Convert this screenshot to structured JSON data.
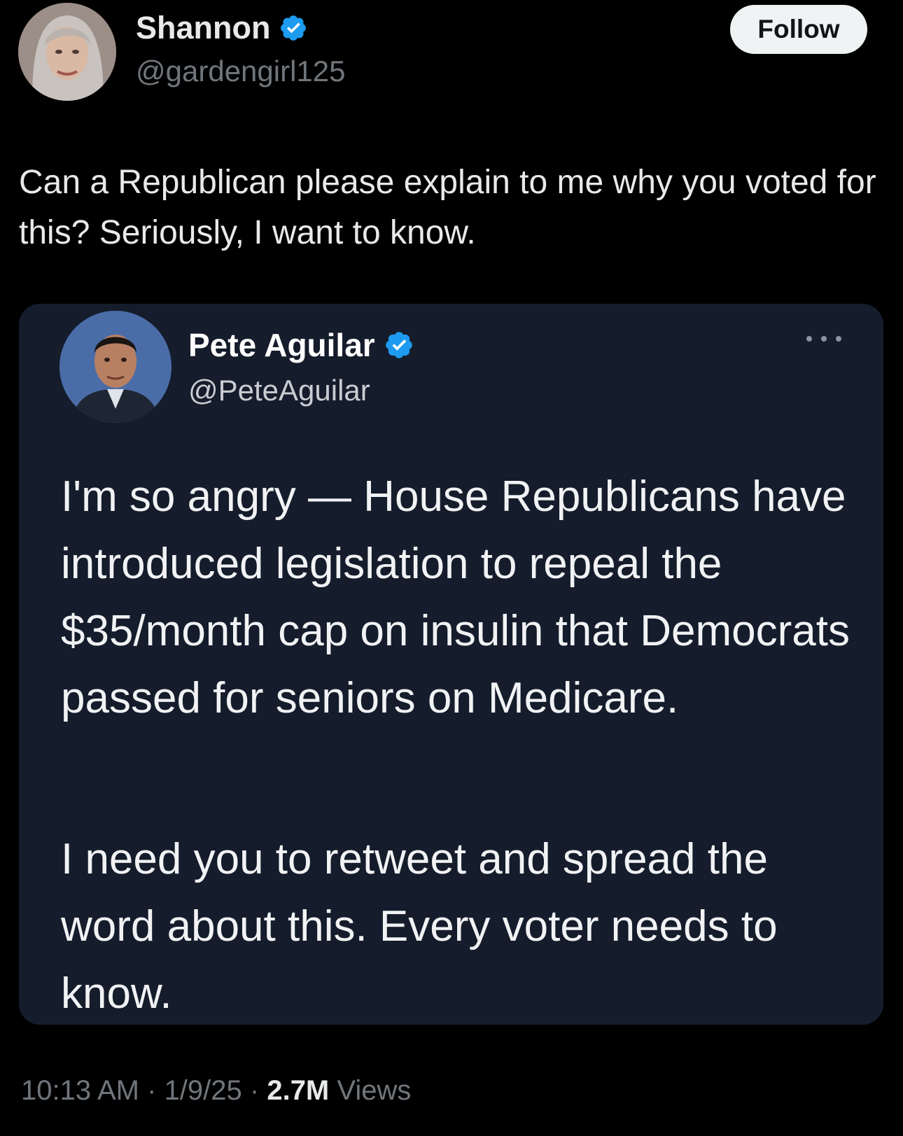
{
  "author": {
    "display_name": "Shannon",
    "handle": "@gardengirl125",
    "verified_color": "#1d9bf0"
  },
  "follow_button": {
    "label": "Follow"
  },
  "tweet": {
    "text": "Can a Republican please explain to me why you voted for this? Seriously, I want to know."
  },
  "quoted": {
    "display_name": "Pete Aguilar",
    "handle": "@PeteAguilar",
    "paragraph1": "I'm so angry — House Republicans have introduced legislation to repeal the $35/month cap on insulin that Democrats passed for seniors on Medicare.",
    "paragraph2": "I need you to retweet and spread the word about this. Every voter needs to know."
  },
  "meta": {
    "time": "10:13 AM",
    "separator": " · ",
    "date": "1/9/25",
    "views_count": "2.7M",
    "views_label": "Views"
  },
  "icons": {
    "verified": "verified-badge-icon",
    "more": "more-options-icon"
  }
}
